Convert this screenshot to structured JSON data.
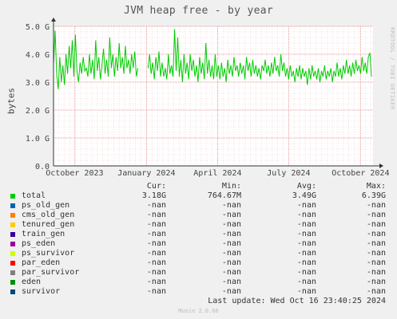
{
  "title": "JVM heap free - by year",
  "side_label": "RRDTOOL / TOBI OETIKER",
  "ylabel": "bytes",
  "chart_data": {
    "type": "line",
    "title": "JVM heap free - by year",
    "ylabel": "bytes",
    "ylim": [
      0,
      5000000000
    ],
    "y_ticks": [
      {
        "value": 0,
        "label": "0.0"
      },
      {
        "value": 1000000000,
        "label": "1.0 G"
      },
      {
        "value": 2000000000,
        "label": "2.0 G"
      },
      {
        "value": 3000000000,
        "label": "3.0 G"
      },
      {
        "value": 4000000000,
        "label": "4.0 G"
      },
      {
        "value": 5000000000,
        "label": "5.0 G"
      }
    ],
    "xlim": [
      "2023-09-04",
      "2024-10-17"
    ],
    "x_ticks": [
      {
        "date": "2023-10-01",
        "label": "October 2023"
      },
      {
        "date": "2024-01-01",
        "label": "January 2024"
      },
      {
        "date": "2024-04-01",
        "label": "April 2024"
      },
      {
        "date": "2024-07-01",
        "label": "July 2024"
      },
      {
        "date": "2024-10-01",
        "label": "October 2024"
      }
    ],
    "grid": true,
    "series": [
      {
        "name": "total",
        "color": "#00cc00",
        "points": [
          {
            "x": "2023-09-04",
            "y": 3.6
          },
          {
            "x": "2023-09-06",
            "y": 4.85
          },
          {
            "x": "2023-09-08",
            "y": 3.3
          },
          {
            "x": "2023-09-10",
            "y": 2.75
          },
          {
            "x": "2023-09-12",
            "y": 3.9
          },
          {
            "x": "2023-09-14",
            "y": 3.0
          },
          {
            "x": "2023-09-16",
            "y": 3.6
          },
          {
            "x": "2023-09-18",
            "y": 2.9
          },
          {
            "x": "2023-09-20",
            "y": 4.0
          },
          {
            "x": "2023-09-22",
            "y": 3.3
          },
          {
            "x": "2023-09-24",
            "y": 4.3
          },
          {
            "x": "2023-09-26",
            "y": 3.5
          },
          {
            "x": "2023-09-28",
            "y": 4.5
          },
          {
            "x": "2023-09-30",
            "y": 3.2
          },
          {
            "x": "2023-10-02",
            "y": 4.7
          },
          {
            "x": "2023-10-04",
            "y": 3.4
          },
          {
            "x": "2023-10-06",
            "y": 3.0
          },
          {
            "x": "2023-10-08",
            "y": 3.7
          },
          {
            "x": "2023-10-10",
            "y": 3.3
          },
          {
            "x": "2023-10-12",
            "y": 3.9
          },
          {
            "x": "2023-10-14",
            "y": 3.4
          },
          {
            "x": "2023-10-16",
            "y": 3.5
          },
          {
            "x": "2023-10-18",
            "y": 3.2
          },
          {
            "x": "2023-10-20",
            "y": 4.0
          },
          {
            "x": "2023-10-22",
            "y": 3.3
          },
          {
            "x": "2023-10-24",
            "y": 3.8
          },
          {
            "x": "2023-10-26",
            "y": 3.1
          },
          {
            "x": "2023-10-28",
            "y": 4.5
          },
          {
            "x": "2023-10-30",
            "y": 3.4
          },
          {
            "x": "2023-11-01",
            "y": 3.9
          },
          {
            "x": "2023-11-03",
            "y": 3.1
          },
          {
            "x": "2023-11-05",
            "y": 3.6
          },
          {
            "x": "2023-11-07",
            "y": 4.2
          },
          {
            "x": "2023-11-09",
            "y": 3.3
          },
          {
            "x": "2023-11-11",
            "y": 3.8
          },
          {
            "x": "2023-11-13",
            "y": 3.2
          },
          {
            "x": "2023-11-15",
            "y": 4.6
          },
          {
            "x": "2023-11-17",
            "y": 3.5
          },
          {
            "x": "2023-11-19",
            "y": 4.0
          },
          {
            "x": "2023-11-21",
            "y": 3.2
          },
          {
            "x": "2023-11-23",
            "y": 3.9
          },
          {
            "x": "2023-11-25",
            "y": 3.4
          },
          {
            "x": "2023-11-27",
            "y": 4.4
          },
          {
            "x": "2023-11-29",
            "y": 3.5
          },
          {
            "x": "2023-12-01",
            "y": 3.9
          },
          {
            "x": "2023-12-03",
            "y": 3.3
          },
          {
            "x": "2023-12-05",
            "y": 4.3
          },
          {
            "x": "2023-12-07",
            "y": 3.5
          },
          {
            "x": "2023-12-09",
            "y": 3.8
          },
          {
            "x": "2023-12-11",
            "y": 3.3
          },
          {
            "x": "2023-12-13",
            "y": 4.0
          },
          {
            "x": "2023-12-15",
            "y": 3.5
          },
          {
            "x": "2023-12-17",
            "y": 4.1
          },
          {
            "x": "2023-12-19",
            "y": 3.2
          },
          {
            "x": "2023-12-21",
            "y": 3.5
          },
          {
            "x": "2024-01-03",
            "y": 3.5
          },
          {
            "x": "2024-01-05",
            "y": 4.0
          },
          {
            "x": "2024-01-07",
            "y": 3.3
          },
          {
            "x": "2024-01-09",
            "y": 3.7
          },
          {
            "x": "2024-01-11",
            "y": 3.1
          },
          {
            "x": "2024-01-13",
            "y": 3.9
          },
          {
            "x": "2024-01-15",
            "y": 3.4
          },
          {
            "x": "2024-01-17",
            "y": 4.1
          },
          {
            "x": "2024-01-19",
            "y": 3.2
          },
          {
            "x": "2024-01-21",
            "y": 3.7
          },
          {
            "x": "2024-01-23",
            "y": 3.2
          },
          {
            "x": "2024-01-25",
            "y": 3.5
          },
          {
            "x": "2024-01-27",
            "y": 3.1
          },
          {
            "x": "2024-01-29",
            "y": 4.0
          },
          {
            "x": "2024-01-31",
            "y": 3.3
          },
          {
            "x": "2024-02-02",
            "y": 3.6
          },
          {
            "x": "2024-02-04",
            "y": 3.2
          },
          {
            "x": "2024-02-06",
            "y": 4.9
          },
          {
            "x": "2024-02-08",
            "y": 3.4
          },
          {
            "x": "2024-02-10",
            "y": 4.6
          },
          {
            "x": "2024-02-12",
            "y": 3.2
          },
          {
            "x": "2024-02-14",
            "y": 3.8
          },
          {
            "x": "2024-02-16",
            "y": 3.0
          },
          {
            "x": "2024-02-18",
            "y": 4.0
          },
          {
            "x": "2024-02-20",
            "y": 3.3
          },
          {
            "x": "2024-02-22",
            "y": 3.7
          },
          {
            "x": "2024-02-24",
            "y": 3.1
          },
          {
            "x": "2024-02-26",
            "y": 4.0
          },
          {
            "x": "2024-02-28",
            "y": 3.4
          },
          {
            "x": "2024-03-01",
            "y": 3.8
          },
          {
            "x": "2024-03-03",
            "y": 3.2
          },
          {
            "x": "2024-03-05",
            "y": 3.6
          },
          {
            "x": "2024-03-07",
            "y": 3.0
          },
          {
            "x": "2024-03-09",
            "y": 3.9
          },
          {
            "x": "2024-03-11",
            "y": 3.3
          },
          {
            "x": "2024-03-13",
            "y": 3.7
          },
          {
            "x": "2024-03-15",
            "y": 3.1
          },
          {
            "x": "2024-03-17",
            "y": 4.4
          },
          {
            "x": "2024-03-19",
            "y": 3.3
          },
          {
            "x": "2024-03-21",
            "y": 3.8
          },
          {
            "x": "2024-03-23",
            "y": 3.2
          },
          {
            "x": "2024-03-25",
            "y": 3.6
          },
          {
            "x": "2024-03-27",
            "y": 3.1
          },
          {
            "x": "2024-03-29",
            "y": 4.0
          },
          {
            "x": "2024-03-31",
            "y": 3.2
          },
          {
            "x": "2024-04-02",
            "y": 3.6
          },
          {
            "x": "2024-04-04",
            "y": 3.1
          },
          {
            "x": "2024-04-06",
            "y": 3.7
          },
          {
            "x": "2024-04-08",
            "y": 3.2
          },
          {
            "x": "2024-04-10",
            "y": 3.5
          },
          {
            "x": "2024-04-12",
            "y": 3.0
          },
          {
            "x": "2024-04-14",
            "y": 3.8
          },
          {
            "x": "2024-04-16",
            "y": 3.3
          },
          {
            "x": "2024-04-18",
            "y": 3.6
          },
          {
            "x": "2024-04-20",
            "y": 3.2
          },
          {
            "x": "2024-04-22",
            "y": 3.9
          },
          {
            "x": "2024-04-24",
            "y": 3.4
          },
          {
            "x": "2024-04-26",
            "y": 3.6
          },
          {
            "x": "2024-04-28",
            "y": 3.2
          },
          {
            "x": "2024-04-30",
            "y": 3.7
          },
          {
            "x": "2024-05-02",
            "y": 3.3
          },
          {
            "x": "2024-05-04",
            "y": 3.6
          },
          {
            "x": "2024-05-06",
            "y": 3.1
          },
          {
            "x": "2024-05-08",
            "y": 3.9
          },
          {
            "x": "2024-05-10",
            "y": 3.4
          },
          {
            "x": "2024-05-12",
            "y": 3.7
          },
          {
            "x": "2024-05-14",
            "y": 3.2
          },
          {
            "x": "2024-05-16",
            "y": 3.8
          },
          {
            "x": "2024-05-18",
            "y": 3.3
          },
          {
            "x": "2024-05-20",
            "y": 3.6
          },
          {
            "x": "2024-05-22",
            "y": 3.2
          },
          {
            "x": "2024-05-24",
            "y": 3.5
          },
          {
            "x": "2024-05-26",
            "y": 3.1
          },
          {
            "x": "2024-05-28",
            "y": 3.6
          },
          {
            "x": "2024-05-30",
            "y": 3.4
          },
          {
            "x": "2024-06-01",
            "y": 3.8
          },
          {
            "x": "2024-06-03",
            "y": 3.3
          },
          {
            "x": "2024-06-05",
            "y": 3.6
          },
          {
            "x": "2024-06-07",
            "y": 3.2
          },
          {
            "x": "2024-06-09",
            "y": 3.7
          },
          {
            "x": "2024-06-11",
            "y": 3.3
          },
          {
            "x": "2024-06-13",
            "y": 3.9
          },
          {
            "x": "2024-06-15",
            "y": 3.4
          },
          {
            "x": "2024-06-17",
            "y": 3.6
          },
          {
            "x": "2024-06-19",
            "y": 3.2
          },
          {
            "x": "2024-06-21",
            "y": 4.0
          },
          {
            "x": "2024-06-23",
            "y": 3.4
          },
          {
            "x": "2024-06-25",
            "y": 3.7
          },
          {
            "x": "2024-06-27",
            "y": 3.2
          },
          {
            "x": "2024-06-29",
            "y": 3.5
          },
          {
            "x": "2024-07-01",
            "y": 3.1
          },
          {
            "x": "2024-07-03",
            "y": 3.6
          },
          {
            "x": "2024-07-05",
            "y": 3.2
          },
          {
            "x": "2024-07-07",
            "y": 3.4
          },
          {
            "x": "2024-07-09",
            "y": 3.0
          },
          {
            "x": "2024-07-11",
            "y": 3.5
          },
          {
            "x": "2024-07-13",
            "y": 3.2
          },
          {
            "x": "2024-07-15",
            "y": 3.6
          },
          {
            "x": "2024-07-17",
            "y": 3.1
          },
          {
            "x": "2024-07-19",
            "y": 3.5
          },
          {
            "x": "2024-07-21",
            "y": 3.2
          },
          {
            "x": "2024-07-23",
            "y": 3.4
          },
          {
            "x": "2024-07-25",
            "y": 2.9
          },
          {
            "x": "2024-07-27",
            "y": 3.5
          },
          {
            "x": "2024-07-29",
            "y": 3.1
          },
          {
            "x": "2024-07-31",
            "y": 3.6
          },
          {
            "x": "2024-08-02",
            "y": 3.2
          },
          {
            "x": "2024-08-04",
            "y": 3.4
          },
          {
            "x": "2024-08-06",
            "y": 3.1
          },
          {
            "x": "2024-08-08",
            "y": 3.5
          },
          {
            "x": "2024-08-10",
            "y": 3.0
          },
          {
            "x": "2024-08-12",
            "y": 3.4
          },
          {
            "x": "2024-08-14",
            "y": 3.2
          },
          {
            "x": "2024-08-16",
            "y": 3.6
          },
          {
            "x": "2024-08-18",
            "y": 3.1
          },
          {
            "x": "2024-08-20",
            "y": 3.4
          },
          {
            "x": "2024-08-22",
            "y": 3.2
          },
          {
            "x": "2024-08-24",
            "y": 3.5
          },
          {
            "x": "2024-08-26",
            "y": 3.0
          },
          {
            "x": "2024-08-28",
            "y": 3.4
          },
          {
            "x": "2024-08-30",
            "y": 3.2
          },
          {
            "x": "2024-09-01",
            "y": 3.7
          },
          {
            "x": "2024-09-03",
            "y": 3.2
          },
          {
            "x": "2024-09-05",
            "y": 3.5
          },
          {
            "x": "2024-09-07",
            "y": 3.1
          },
          {
            "x": "2024-09-09",
            "y": 3.6
          },
          {
            "x": "2024-09-11",
            "y": 3.3
          },
          {
            "x": "2024-09-13",
            "y": 3.8
          },
          {
            "x": "2024-09-15",
            "y": 3.3
          },
          {
            "x": "2024-09-17",
            "y": 3.6
          },
          {
            "x": "2024-09-19",
            "y": 3.2
          },
          {
            "x": "2024-09-21",
            "y": 3.7
          },
          {
            "x": "2024-09-23",
            "y": 3.3
          },
          {
            "x": "2024-09-25",
            "y": 3.8
          },
          {
            "x": "2024-09-27",
            "y": 3.4
          },
          {
            "x": "2024-09-29",
            "y": 3.6
          },
          {
            "x": "2024-10-01",
            "y": 3.3
          },
          {
            "x": "2024-10-03",
            "y": 3.9
          },
          {
            "x": "2024-10-05",
            "y": 3.4
          },
          {
            "x": "2024-10-07",
            "y": 3.7
          },
          {
            "x": "2024-10-09",
            "y": 3.3
          },
          {
            "x": "2024-10-11",
            "y": 3.9
          },
          {
            "x": "2024-10-13",
            "y": 4.05
          },
          {
            "x": "2024-10-15",
            "y": 3.2
          }
        ]
      }
    ]
  },
  "legend": {
    "headers": [
      "Cur:",
      "Min:",
      "Avg:",
      "Max:"
    ],
    "rows": [
      {
        "name": "total",
        "color": "#00cc00",
        "cur": "3.18G",
        "min": "764.67M",
        "avg": "3.49G",
        "max": "6.39G"
      },
      {
        "name": "ps_old_gen",
        "color": "#0066b3",
        "cur": "-nan",
        "min": "-nan",
        "avg": "-nan",
        "max": "-nan"
      },
      {
        "name": "cms_old_gen",
        "color": "#ff8000",
        "cur": "-nan",
        "min": "-nan",
        "avg": "-nan",
        "max": "-nan"
      },
      {
        "name": "tenured_gen",
        "color": "#ffcc00",
        "cur": "-nan",
        "min": "-nan",
        "avg": "-nan",
        "max": "-nan"
      },
      {
        "name": "train_gen",
        "color": "#330099",
        "cur": "-nan",
        "min": "-nan",
        "avg": "-nan",
        "max": "-nan"
      },
      {
        "name": "ps_eden",
        "color": "#990099",
        "cur": "-nan",
        "min": "-nan",
        "avg": "-nan",
        "max": "-nan"
      },
      {
        "name": "ps_survivor",
        "color": "#ccff00",
        "cur": "-nan",
        "min": "-nan",
        "avg": "-nan",
        "max": "-nan"
      },
      {
        "name": "par_eden",
        "color": "#ff0000",
        "cur": "-nan",
        "min": "-nan",
        "avg": "-nan",
        "max": "-nan"
      },
      {
        "name": "par_survivor",
        "color": "#808080",
        "cur": "-nan",
        "min": "-nan",
        "avg": "-nan",
        "max": "-nan"
      },
      {
        "name": "eden",
        "color": "#008f00",
        "cur": "-nan",
        "min": "-nan",
        "avg": "-nan",
        "max": "-nan"
      },
      {
        "name": "survivor",
        "color": "#00487d",
        "cur": "-nan",
        "min": "-nan",
        "avg": "-nan",
        "max": "-nan"
      }
    ]
  },
  "last_update": "Last update: Wed Oct 16 23:40:25 2024",
  "munin_version": "Munin 2.0.66"
}
